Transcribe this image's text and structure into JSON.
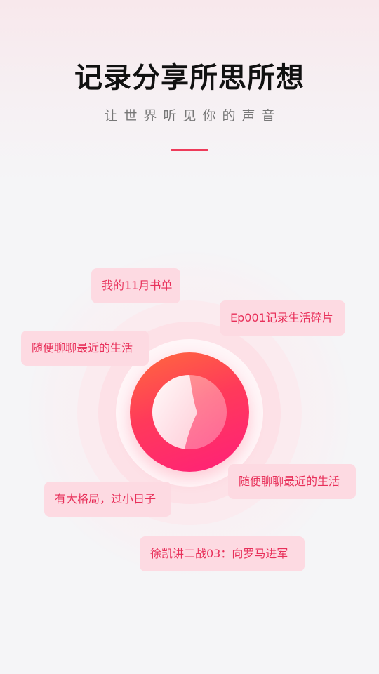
{
  "header": {
    "title": "记录分享所思所想",
    "subtitle": "让世界听见你的声音"
  },
  "record": {
    "icon": "record-mic-icon"
  },
  "tags": [
    "我的11月书单",
    "Ep001记录生活碎片",
    "随便聊聊最近的生活",
    "随便聊聊最近的生活",
    "有大格局，过小日子",
    "徐凯讲二战03：向罗马进军"
  ],
  "colors": {
    "accent": "#ee3b5a",
    "button_gradient_start": "#ff6a3d",
    "button_gradient_end": "#ff1f7a",
    "tag_background": "#fddae2",
    "tag_text": "#e8305a",
    "title_text": "#111111",
    "subtitle_text": "#777777"
  }
}
